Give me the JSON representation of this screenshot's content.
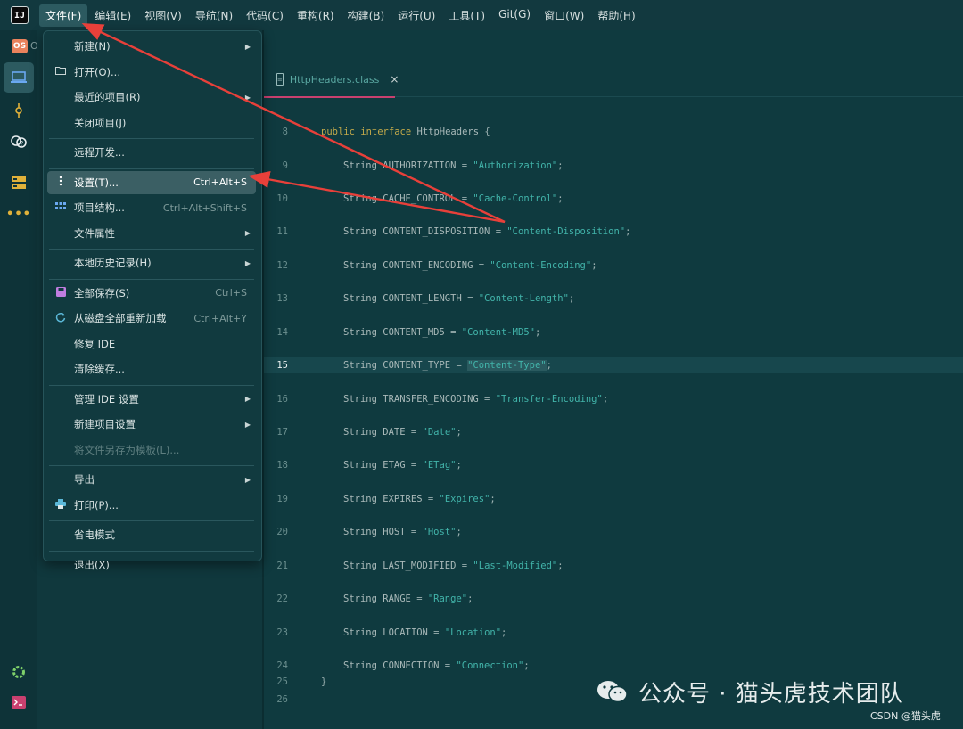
{
  "menubar": {
    "items": [
      "文件(F)",
      "编辑(E)",
      "视图(V)",
      "导航(N)",
      "代码(C)",
      "重构(R)",
      "构建(B)",
      "运行(U)",
      "工具(T)",
      "Git(G)",
      "窗口(W)",
      "帮助(H)"
    ]
  },
  "toolstrip": {
    "project_badge": "OS",
    "badge_suffix": "O"
  },
  "editor": {
    "tab": {
      "title": "HttpHeaders.class",
      "close": "×"
    },
    "current_line": 15,
    "lines": [
      {
        "no": "8",
        "text": "public interface HttpHeaders {"
      },
      {
        "no": "9",
        "name": "AUTHORIZATION",
        "value": "\"Authorization\""
      },
      {
        "no": "10",
        "name": "CACHE_CONTROL",
        "value": "\"Cache-Control\""
      },
      {
        "no": "11",
        "name": "CONTENT_DISPOSITION",
        "value": "\"Content-Disposition\""
      },
      {
        "no": "12",
        "name": "CONTENT_ENCODING",
        "value": "\"Content-Encoding\""
      },
      {
        "no": "13",
        "name": "CONTENT_LENGTH",
        "value": "\"Content-Length\""
      },
      {
        "no": "14",
        "name": "CONTENT_MD5",
        "value": "\"Content-MD5\""
      },
      {
        "no": "15",
        "name": "CONTENT_TYPE",
        "value": "\"Content-Type\""
      },
      {
        "no": "16",
        "name": "TRANSFER_ENCODING",
        "value": "\"Transfer-Encoding\""
      },
      {
        "no": "17",
        "name": "DATE",
        "value": "\"Date\""
      },
      {
        "no": "18",
        "name": "ETAG",
        "value": "\"ETag\""
      },
      {
        "no": "19",
        "name": "EXPIRES",
        "value": "\"Expires\""
      },
      {
        "no": "20",
        "name": "HOST",
        "value": "\"Host\""
      },
      {
        "no": "21",
        "name": "LAST_MODIFIED",
        "value": "\"Last-Modified\""
      },
      {
        "no": "22",
        "name": "RANGE",
        "value": "\"Range\""
      },
      {
        "no": "23",
        "name": "LOCATION",
        "value": "\"Location\""
      },
      {
        "no": "24",
        "name": "CONNECTION",
        "value": "\"Connection\""
      },
      {
        "no": "25",
        "text": "}"
      },
      {
        "no": "26",
        "text": ""
      }
    ],
    "type_keyword": "String",
    "decl_keywords": [
      "public",
      "interface"
    ],
    "class_name": "HttpHeaders"
  },
  "file_menu": {
    "items": [
      {
        "label": "新建(N)",
        "icon": "",
        "submenu": true
      },
      {
        "label": "打开(O)...",
        "icon": "folder-icon"
      },
      {
        "label": "最近的项目(R)",
        "submenu": true
      },
      {
        "label": "关闭项目(J)"
      },
      {
        "sep": true
      },
      {
        "label": "远程开发..."
      },
      {
        "sep": true
      },
      {
        "label": "设置(T)...",
        "shortcut": "Ctrl+Alt+S",
        "icon": "settings-dots-icon",
        "selected": true
      },
      {
        "label": "项目结构...",
        "shortcut": "Ctrl+Alt+Shift+S",
        "icon": "project-structure-icon"
      },
      {
        "label": "文件属性",
        "submenu": true
      },
      {
        "sep": true
      },
      {
        "label": "本地历史记录(H)",
        "submenu": true
      },
      {
        "sep": true
      },
      {
        "label": "全部保存(S)",
        "shortcut": "Ctrl+S",
        "icon": "save-icon"
      },
      {
        "label": "从磁盘全部重新加载",
        "shortcut": "Ctrl+Alt+Y",
        "icon": "reload-icon"
      },
      {
        "label": "修复 IDE"
      },
      {
        "label": "清除缓存..."
      },
      {
        "sep": true
      },
      {
        "label": "管理 IDE 设置",
        "submenu": true
      },
      {
        "label": "新建项目设置",
        "submenu": true
      },
      {
        "label": "将文件另存为模板(L)...",
        "disabled": true
      },
      {
        "sep": true
      },
      {
        "label": "导出",
        "submenu": true
      },
      {
        "label": "打印(P)...",
        "icon": "print-icon"
      },
      {
        "sep": true
      },
      {
        "label": "省电模式"
      },
      {
        "sep": true
      },
      {
        "label": "退出(X)"
      }
    ]
  },
  "watermark": {
    "text": "公众号 · 猫头虎技术团队",
    "credit": "CSDN @猫头虎"
  },
  "colors": {
    "accent": "#e8403a",
    "background": "#0f3a3f",
    "string": "#42b4aa",
    "keyword": "#c2a94a"
  }
}
